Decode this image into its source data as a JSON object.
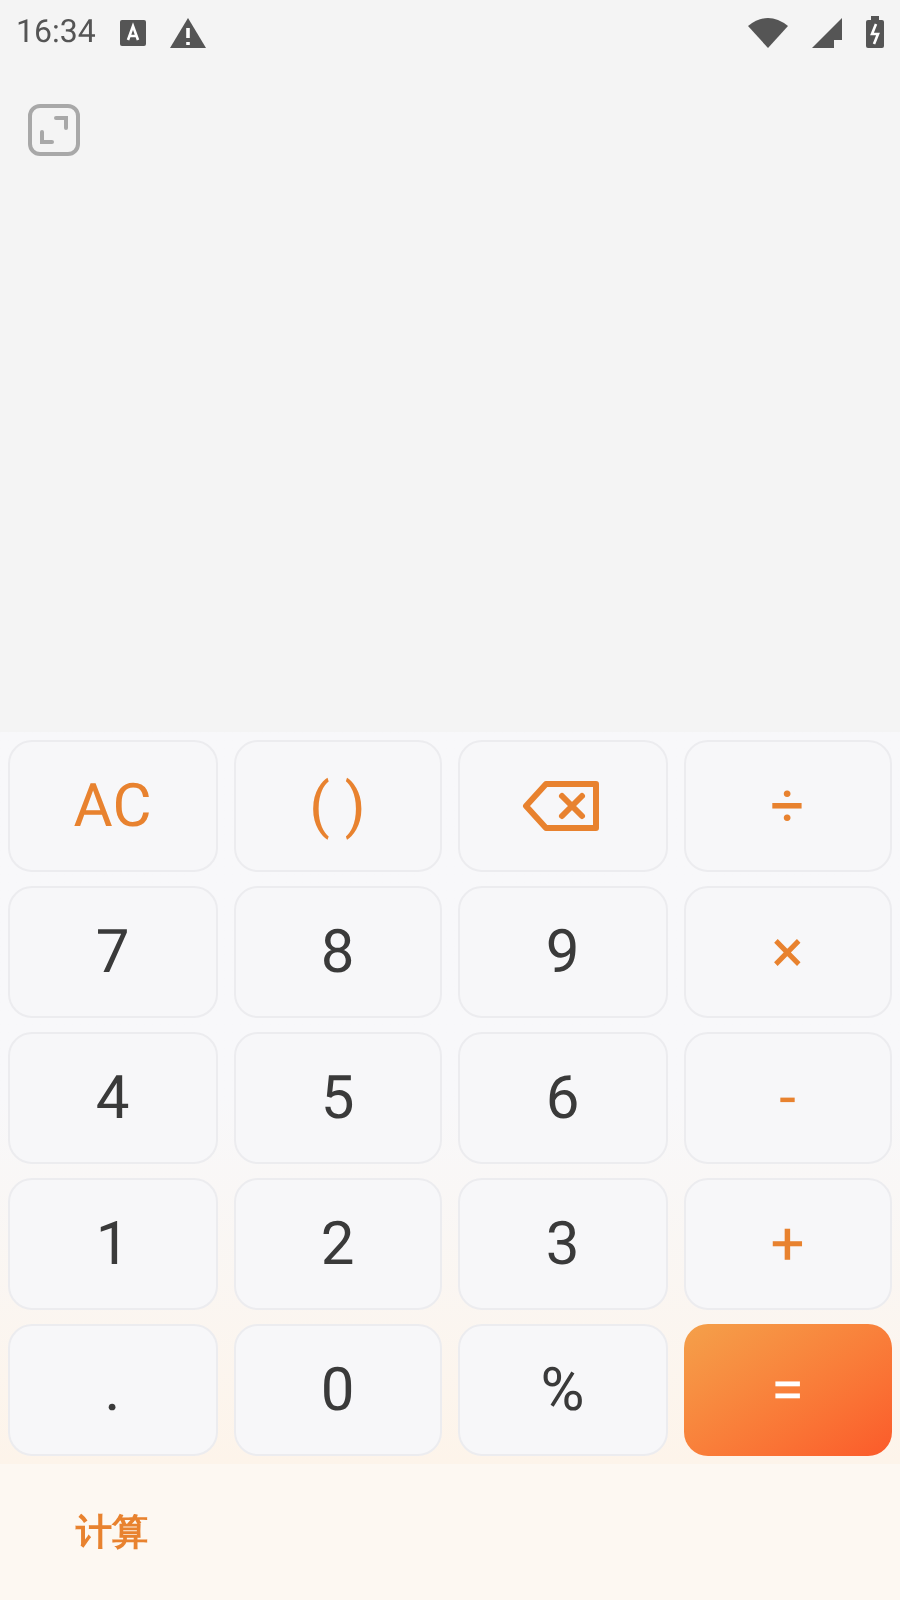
{
  "status_bar": {
    "time": "16:34"
  },
  "keys": [
    {
      "label": "AC",
      "kind": "op"
    },
    {
      "label": "( )",
      "kind": "op"
    },
    {
      "kind": "backspace"
    },
    {
      "label": "÷",
      "kind": "op"
    },
    {
      "label": "7",
      "kind": "digit"
    },
    {
      "label": "8",
      "kind": "digit"
    },
    {
      "label": "9",
      "kind": "digit"
    },
    {
      "label": "×",
      "kind": "op"
    },
    {
      "label": "4",
      "kind": "digit"
    },
    {
      "label": "5",
      "kind": "digit"
    },
    {
      "label": "6",
      "kind": "digit"
    },
    {
      "label": "-",
      "kind": "op"
    },
    {
      "label": "1",
      "kind": "digit"
    },
    {
      "label": "2",
      "kind": "digit"
    },
    {
      "label": "3",
      "kind": "digit"
    },
    {
      "label": "+",
      "kind": "op"
    },
    {
      "label": ".",
      "kind": "digit"
    },
    {
      "label": "0",
      "kind": "digit"
    },
    {
      "label": "%",
      "kind": "digit"
    },
    {
      "label": "=",
      "kind": "equals"
    }
  ],
  "tabs": [
    {
      "label": "计算",
      "selected": true
    }
  ]
}
